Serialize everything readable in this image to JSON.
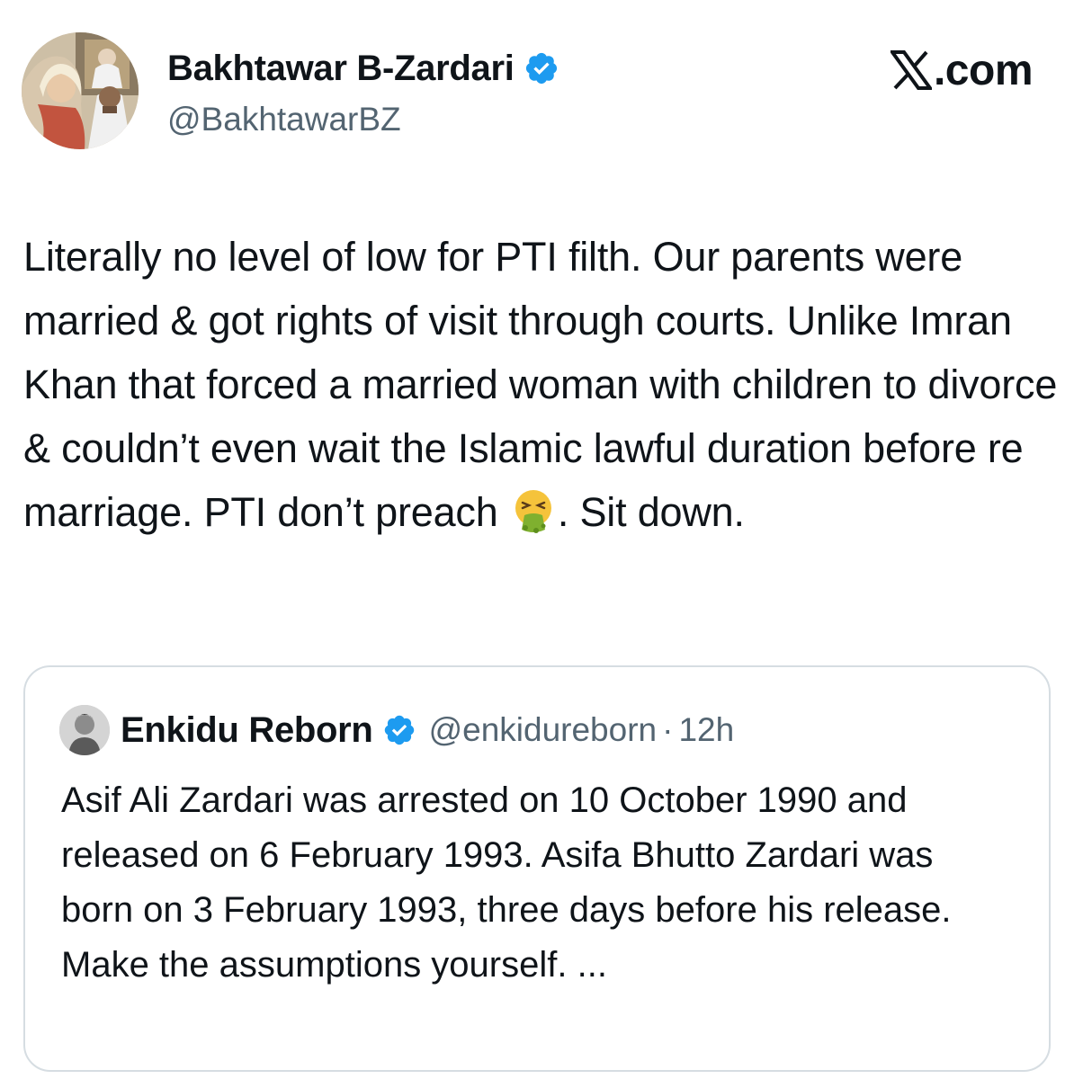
{
  "author": {
    "name": "Bakhtawar B-Zardari",
    "handle": "@BakhtawarBZ",
    "avatar_icon": "profile-photo",
    "verified": true
  },
  "brand": {
    "text": "X.com",
    "icon": "x-logo-icon"
  },
  "tweet": {
    "text": "Literally no level of low for PTI filth. Our parents were married & got rights of visit through courts. Unlike Imran Khan that forced a married woman with children to divorce & couldn’t even wait the Islamic lawful duration before re marriage. PTI don’t preach",
    "emoji": "nauseated-vomiting-face-icon",
    "text_after_emoji": ". Sit down."
  },
  "quote": {
    "name": "Enkidu Reborn",
    "handle": "@enkidureborn",
    "separator": "·",
    "time": "12h",
    "verified": true,
    "text": "Asif Ali Zardari was arrested on 10 October 1990 and released on 6 February 1993. Asifa Bhutto Zardari was born on 3 February 1993, three days before his release. Make the assumptions yourself. ..."
  },
  "colors": {
    "verified_blue": "#1d9bf0",
    "secondary_text": "#536471",
    "primary_text": "#0f1419",
    "card_border": "#d6dde2"
  }
}
